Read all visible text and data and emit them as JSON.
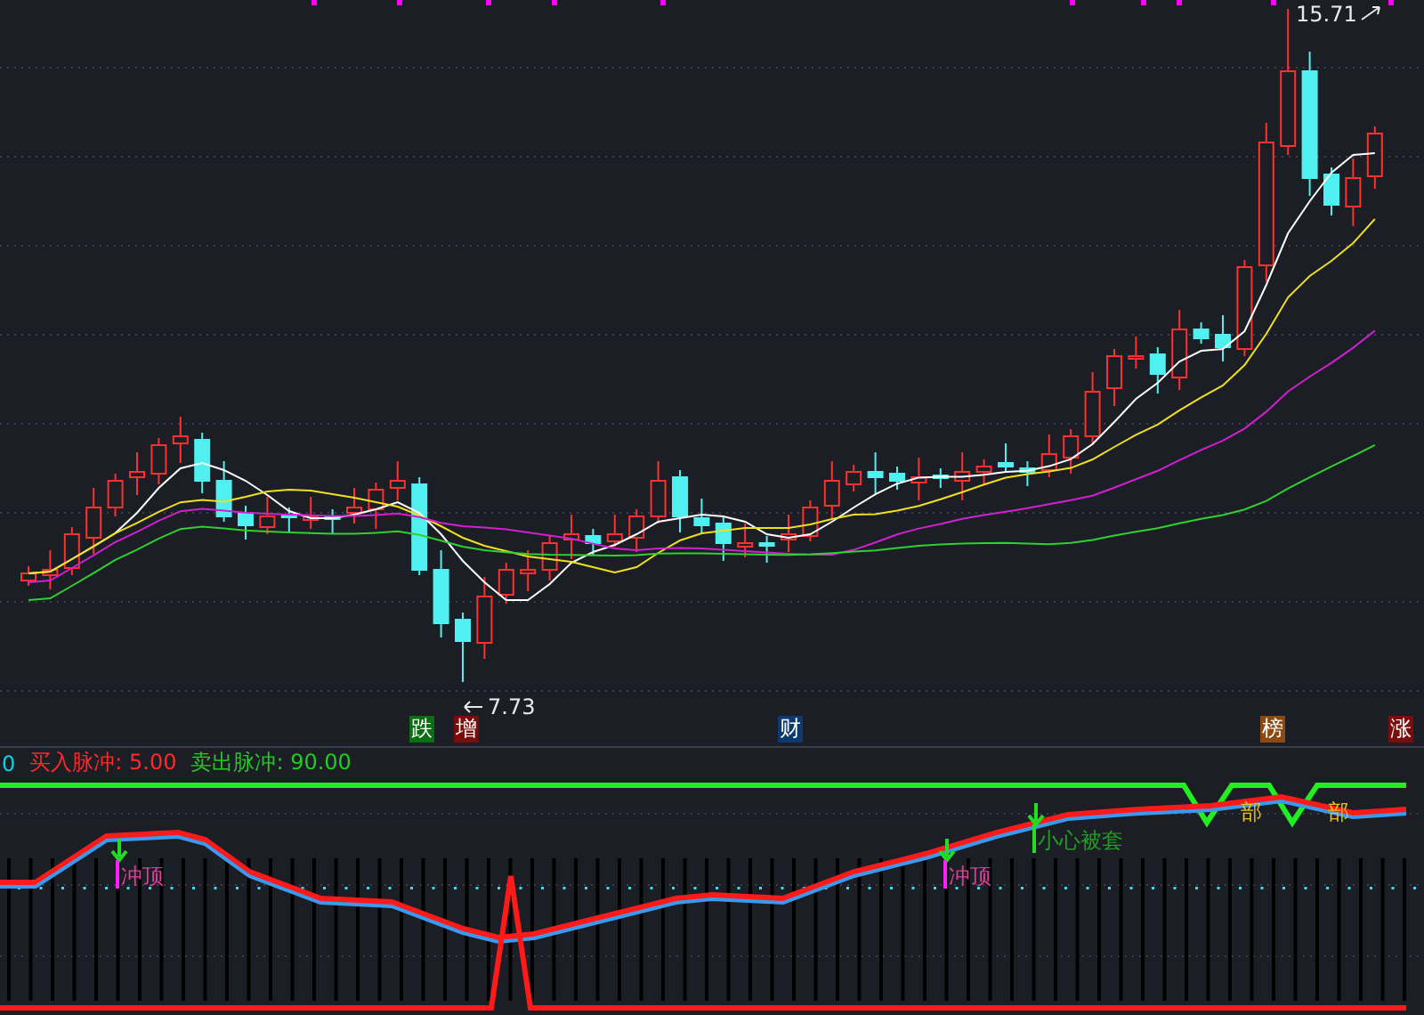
{
  "price_chart": {
    "high_label": "15.71",
    "low_label": "7.73"
  },
  "event_markers": [
    {
      "label": "跌",
      "color": "#0b6e12"
    },
    {
      "label": "增",
      "color": "#7a0c0c"
    },
    {
      "label": "财",
      "color": "#0c3a6e"
    },
    {
      "label": "榜",
      "color": "#8a4a12"
    },
    {
      "label": "涨",
      "color": "#7a0c0c"
    }
  ],
  "indicator": {
    "legend": [
      {
        "text": "0",
        "color": "#00d8e8"
      },
      {
        "text": "买入脉冲: 5.00",
        "color": "#ff2a2a"
      },
      {
        "text": "卖出脉冲: 90.00",
        "color": "#22cc22"
      }
    ],
    "signals": [
      {
        "kind": "top",
        "label": "冲顶"
      },
      {
        "kind": "top",
        "label": "冲顶"
      },
      {
        "kind": "caution",
        "label": "小心被套"
      },
      {
        "kind": "bottom",
        "label": "部"
      },
      {
        "kind": "bottom",
        "label": "部"
      }
    ]
  }
}
